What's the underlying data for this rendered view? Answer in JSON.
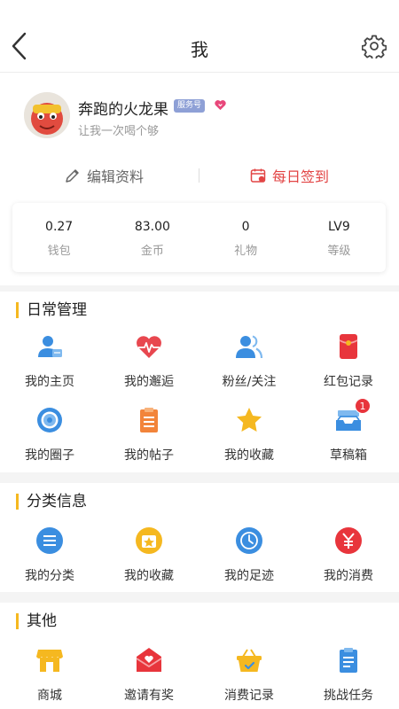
{
  "header": {
    "title": "我",
    "back_icon": "chevron-left-icon",
    "settings_icon": "gear-icon"
  },
  "profile": {
    "username": "奔跑的火龙果",
    "badge": "服务号",
    "signature": "让我一次喝个够",
    "edit_label": "编辑资料",
    "checkin_label": "每日签到"
  },
  "stats": [
    {
      "value": "0.27",
      "label": "钱包"
    },
    {
      "value": "83.00",
      "label": "金币"
    },
    {
      "value": "0",
      "label": "礼物"
    },
    {
      "value": "LV9",
      "label": "等级"
    }
  ],
  "daily": {
    "title": "日常管理",
    "items": [
      {
        "label": "我的主页",
        "icon": "user-card-icon"
      },
      {
        "label": "我的邂逅",
        "icon": "heartbeat-icon"
      },
      {
        "label": "粉丝/关注",
        "icon": "users-icon"
      },
      {
        "label": "红包记录",
        "icon": "red-envelope-icon"
      },
      {
        "label": "我的圈子",
        "icon": "target-icon"
      },
      {
        "label": "我的帖子",
        "icon": "clipboard-icon"
      },
      {
        "label": "我的收藏",
        "icon": "star-icon"
      },
      {
        "label": "草稿箱",
        "icon": "inbox-icon",
        "badge": "1"
      }
    ]
  },
  "category": {
    "title": "分类信息",
    "items": [
      {
        "label": "我的分类",
        "icon": "list-icon"
      },
      {
        "label": "我的收藏",
        "icon": "star-box-icon"
      },
      {
        "label": "我的足迹",
        "icon": "clock-icon"
      },
      {
        "label": "我的消费",
        "icon": "yen-icon"
      }
    ]
  },
  "other": {
    "title": "其他",
    "items": [
      {
        "label": "商城",
        "icon": "shop-icon"
      },
      {
        "label": "邀请有奖",
        "icon": "mail-heart-icon"
      },
      {
        "label": "消费记录",
        "icon": "basket-icon"
      },
      {
        "label": "挑战任务",
        "icon": "task-icon"
      }
    ]
  },
  "colors": {
    "accent": "#f5b820",
    "red": "#e8353c",
    "blue": "#3b8ee0",
    "orange": "#f2843a"
  }
}
